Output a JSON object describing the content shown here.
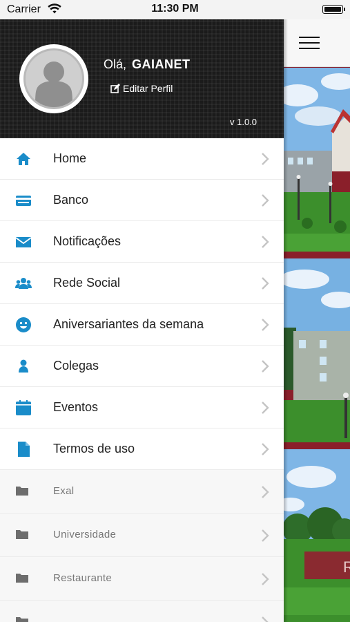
{
  "status_bar": {
    "carrier": "Carrier",
    "time": "11:30 PM",
    "wifi_icon": "wifi-icon",
    "battery_icon": "battery-icon"
  },
  "profile": {
    "greeting": "Olá,",
    "user_name": "GAIANET",
    "edit_label": "Editar Perfil",
    "version": "v 1.0.0"
  },
  "menu": {
    "items": [
      {
        "label": "Home",
        "icon": "home-icon"
      },
      {
        "label": "Banco",
        "icon": "credit-card-icon"
      },
      {
        "label": "Notificações",
        "icon": "envelope-icon"
      },
      {
        "label": "Rede Social",
        "icon": "users-icon"
      },
      {
        "label": "Aniversariantes da semana",
        "icon": "smiley-icon"
      },
      {
        "label": "Colegas",
        "icon": "person-icon"
      },
      {
        "label": "Eventos",
        "icon": "calendar-icon"
      },
      {
        "label": "Termos de uso",
        "icon": "document-icon"
      }
    ],
    "folders": [
      {
        "label": "Exal",
        "icon": "folder-icon"
      },
      {
        "label": "Universidade",
        "icon": "folder-icon"
      },
      {
        "label": "Restaurante",
        "icon": "folder-icon"
      }
    ]
  },
  "colors": {
    "accent": "#1a8cc9",
    "header_bg": "#1b1b1b",
    "folder_icon": "#6d6d6d",
    "chevron": "#c4c4c4",
    "content_bg": "#8a1f2a"
  }
}
